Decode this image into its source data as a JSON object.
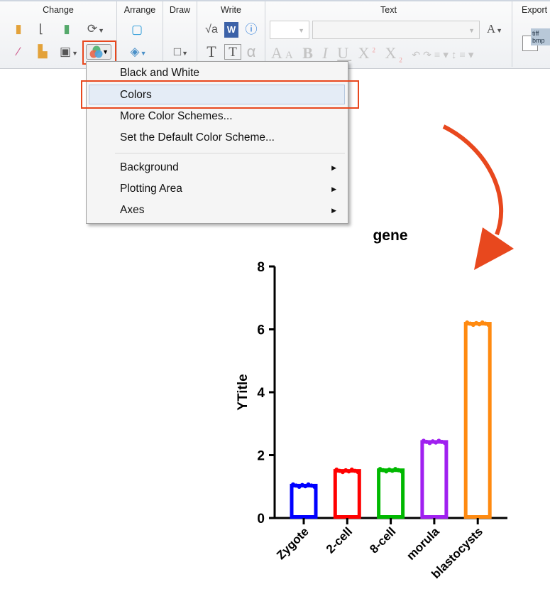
{
  "toolbar": {
    "groups": {
      "change": "Change",
      "arrange": "Arrange",
      "draw": "Draw",
      "write": "Write",
      "text": "Text",
      "export": "Export"
    },
    "icons": [
      "chart-type-icon",
      "axes-icon",
      "swap-axes-icon",
      "refresh-icon",
      "magic-wand-icon",
      "add-data-icon",
      "resize-chart-icon",
      "color-scheme-icon",
      "bring-front-icon",
      "rotate-objects-icon",
      "rectangle-icon",
      "equation-icon",
      "word-icon",
      "info-icon",
      "text-icon",
      "text-box-icon",
      "alpha-icon",
      "font-color-icon",
      "increase-font-icon",
      "decrease-font-icon",
      "bold-icon",
      "italic-icon",
      "underline-icon",
      "superscript-icon",
      "subscript-icon",
      "rotate-left-icon",
      "rotate-right-icon",
      "align-icon",
      "line-spacing-icon",
      "export-icon"
    ],
    "export_icon_text": "tiff bmp",
    "font_size_value": "",
    "font_name_value": "",
    "b": "B",
    "i": "I",
    "u": "U",
    "x": "X",
    "sup": "2",
    "sub": "2",
    "a": "A",
    "alpha": "α",
    "T": "T",
    "sqrt": "√a",
    "W": "W"
  },
  "menu": {
    "items": [
      {
        "label": "Black and White"
      },
      {
        "label": "Colors",
        "selected": true
      },
      {
        "label": "More Color Schemes..."
      },
      {
        "label": "Set the Default Color Scheme..."
      },
      {
        "label": "Background",
        "submenu": true
      },
      {
        "label": "Plotting Area",
        "submenu": true
      },
      {
        "label": "Axes",
        "submenu": true
      }
    ]
  },
  "annotation_color": "#e8481e",
  "chart_data": {
    "type": "bar",
    "title": "gene",
    "ylabel": "YTitle",
    "xlabel": "",
    "categories": [
      "Zygote",
      "2-cell",
      "8-cell",
      "morula",
      "blastocysts"
    ],
    "values": [
      1.03,
      1.5,
      1.52,
      2.42,
      6.18
    ],
    "colors": [
      "#0000ff",
      "#ff0000",
      "#00b800",
      "#a020f0",
      "#ff8a10"
    ],
    "ylim": [
      0,
      8
    ],
    "yticks": [
      0,
      2,
      4,
      6,
      8
    ],
    "bar_style": "hollow",
    "grid": false
  }
}
